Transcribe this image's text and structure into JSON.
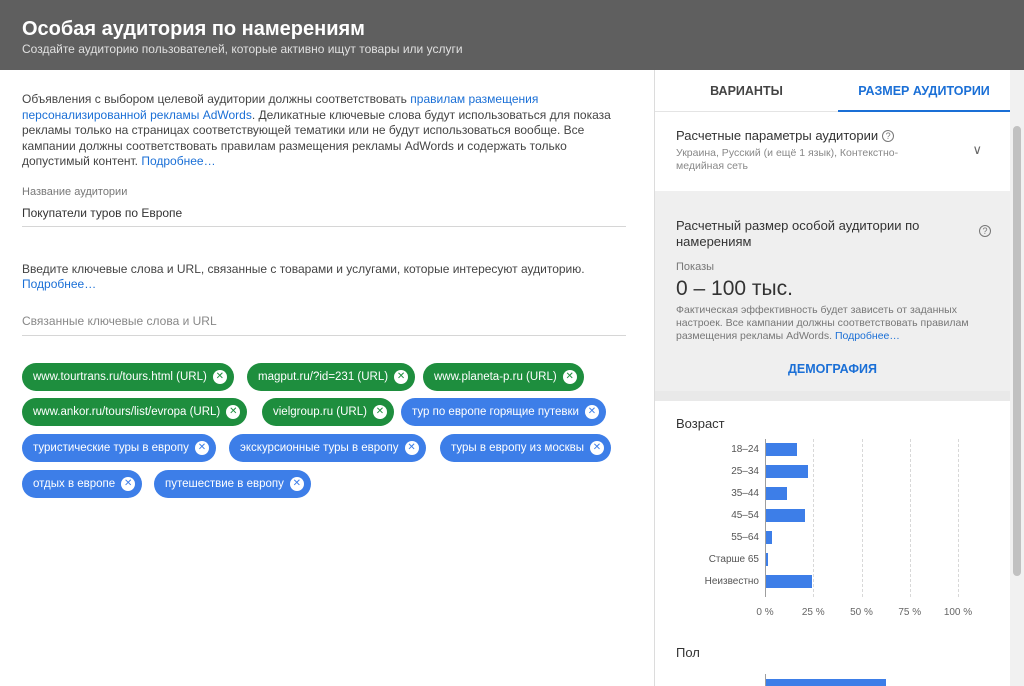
{
  "header": {
    "title": "Особая аудитория по намерениям",
    "subtitle": "Создайте аудиторию пользователей, которые активно ищут товары или услуги"
  },
  "intro": {
    "before": "Объявления с выбором целевой аудитории должны соответствовать ",
    "link": "правилам размещения персонализированной рекламы AdWords",
    "after": ". Деликатные ключевые слова будут использоваться для показа рекламы только на страницах соответствующей тематики или не будут использоваться вообще. Все кампании должны соответствовать правилам размещения рекламы AdWords и содержать только допустимый контент. ",
    "more": "Подробнее…"
  },
  "audience_name": {
    "label": "Название аудитории",
    "value": "Покупатели туров по Европе"
  },
  "keywords_help": {
    "text": "Введите ключевые слова и URL, связанные с товарами и услугами, которые интересуют аудиторию.",
    "more": "Подробнее…"
  },
  "keywords_field": {
    "placeholder": "Связанные ключевые слова и URL"
  },
  "chips": [
    {
      "label": "www.tourtrans.ru/tours.html (URL)",
      "color": "#1e8e3e"
    },
    {
      "label": "magput.ru/?id=231 (URL)",
      "color": "#1e8e3e"
    },
    {
      "label": "www.planeta-p.ru (URL)",
      "color": "#1e8e3e"
    },
    {
      "label": "www.ankor.ru/tours/list/evropa (URL)",
      "color": "#1e8e3e"
    },
    {
      "label": "vielgroup.ru (URL)",
      "color": "#1e8e3e"
    },
    {
      "label": "тур по европе горящие путевки",
      "color": "#3d7ee8"
    },
    {
      "label": "туристические туры в европу",
      "color": "#3d7ee8"
    },
    {
      "label": "экскурсионные туры в европу",
      "color": "#3d7ee8"
    },
    {
      "label": "туры в европу из москвы",
      "color": "#3d7ee8"
    },
    {
      "label": "отдых в европе",
      "color": "#3d7ee8"
    },
    {
      "label": "путешествие в европу",
      "color": "#3d7ee8"
    }
  ],
  "tabs": [
    {
      "label": "ВАРИАНТЫ",
      "active": false
    },
    {
      "label": "РАЗМЕР АУДИТОРИИ",
      "active": true
    }
  ],
  "params": {
    "title": "Расчетные параметры аудитории",
    "summary": "Украина, Русский (и ещё 1 язык), Контекстно-медийная сеть"
  },
  "size": {
    "title": "Расчетный размер особой аудитории по намерениям",
    "impressions_label": "Показы",
    "value": "0 – 100 тыс.",
    "note": "Фактическая эффективность будет зависеть от заданных настроек. Все кампании должны соответствовать правилам размещения рекламы AdWords. ",
    "more": "Подробнее…",
    "demographics_button": "ДЕМОГРАФИЯ"
  },
  "chart_data": [
    {
      "type": "bar",
      "title": "Возраст",
      "orientation": "horizontal",
      "categories": [
        "18–24",
        "25–34",
        "35–44",
        "45–54",
        "55–64",
        "Старше 65",
        "Неизвестно"
      ],
      "values": [
        16,
        22,
        11,
        20,
        3,
        1,
        24
      ],
      "xlim": [
        0,
        100
      ],
      "xticks": [
        "0 %",
        "25 %",
        "50 %",
        "75 %",
        "100 %"
      ],
      "unit": "%",
      "color": "#3d7ee8",
      "grid": true
    },
    {
      "type": "bar",
      "title": "Пол",
      "orientation": "horizontal",
      "categories": [
        ""
      ],
      "values": [
        62
      ],
      "xlim": [
        0,
        100
      ],
      "color": "#3d7ee8"
    }
  ]
}
